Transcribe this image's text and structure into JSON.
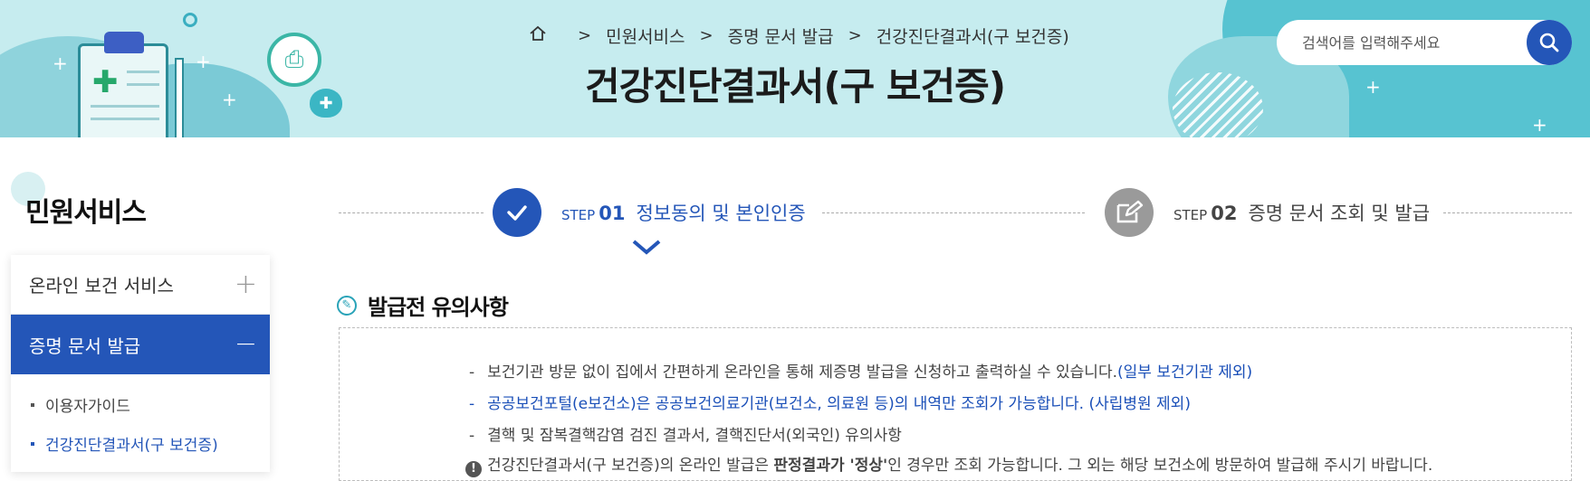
{
  "header": {
    "breadcrumb": [
      "민원서비스",
      "증명 문서 발급",
      "건강진단결과서(구 보건증)"
    ],
    "title": "건강진단결과서(구 보건증)",
    "search_placeholder": "검색어를 입력해주세요",
    "colors": {
      "banner": "#c6ecef",
      "accent": "#2456b8"
    }
  },
  "sidebar": {
    "title": "민원서비스",
    "items": [
      {
        "label": "온라인 보건 서비스",
        "toggle": "+"
      },
      {
        "label": "증명 문서 발급",
        "toggle": "−"
      }
    ],
    "sub_items": [
      {
        "label": "이용자가이드"
      },
      {
        "label": "건강진단결과서(구 보건증)"
      }
    ]
  },
  "steps": [
    {
      "step": "STEP",
      "num": "01",
      "label": "정보동의 및 본인인증",
      "state": "active",
      "icon": "check-icon"
    },
    {
      "step": "STEP",
      "num": "02",
      "label": "증명 문서 조회 및 발급",
      "state": "inactive",
      "icon": "edit-icon"
    }
  ],
  "notice": {
    "title": "발급전 유의사항",
    "lines": [
      {
        "dash": "-",
        "text": "보건기관 방문 없이 집에서 간편하게 온라인을 통해 제증명 발급을 신청하고 출력하실 수 있습니다.",
        "note": "(일부 보건기관 제외)"
      },
      {
        "dash": "-",
        "text": "공공보건포털(e보건소)은 공공보건의료기관(보건소, 의료원 등)의 내역만 조회가 가능합니다. (사립병원 제외)"
      },
      {
        "dash": "-",
        "text": "결핵 및 잠복결핵감염 검진 결과서, 결핵진단서(외국인) 유의사항"
      },
      {
        "text_before": "건강진단결과서(구 보건증)의 온라인 발급은 ",
        "emphasis": "판정결과가 '정상'",
        "text_after": "인 경우만 조회 가능합니다. 그 외는 해당 보건소에 방문하여 발급해 주시기 바랍니다."
      }
    ]
  }
}
